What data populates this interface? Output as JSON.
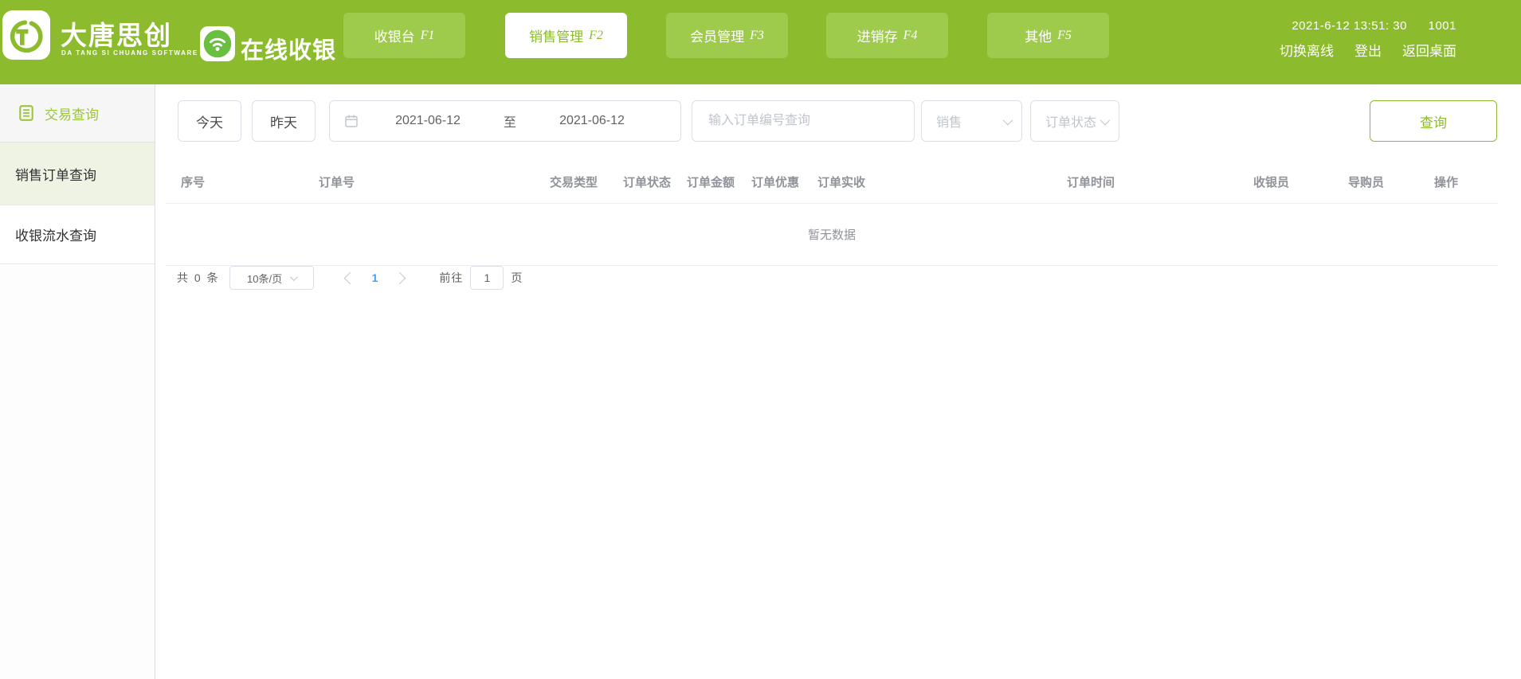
{
  "header": {
    "brand": {
      "name": "大唐思创",
      "subtitle": "DA TANG SI CHUANG SOFTWARE",
      "product": "在线收银"
    },
    "nav": [
      {
        "label": "收银台",
        "fkey": "F1"
      },
      {
        "label": "销售管理",
        "fkey": "F2"
      },
      {
        "label": "会员管理",
        "fkey": "F3"
      },
      {
        "label": "进销存",
        "fkey": "F4"
      },
      {
        "label": "其他",
        "fkey": "F5"
      }
    ],
    "info": {
      "datetime": "2021-6-12 13:51: 30",
      "terminal": "1001",
      "links": {
        "switch_offline": "切换离线",
        "logout": "登出",
        "back_desktop": "返回桌面"
      }
    }
  },
  "sidebar": {
    "items": [
      {
        "label": "交易查询",
        "icon": "document-list-icon"
      },
      {
        "label": "销售订单查询"
      },
      {
        "label": "收银流水查询"
      }
    ]
  },
  "filters": {
    "today": "今天",
    "yesterday": "昨天",
    "date_from": "2021-06-12",
    "to_label": "至",
    "date_to": "2021-06-12",
    "order_placeholder": "输入订单编号查询",
    "type_value": "销售",
    "status_placeholder": "订单状态",
    "search_label": "查询"
  },
  "table": {
    "columns": [
      "序号",
      "订单号",
      "交易类型",
      "订单状态",
      "订单金额",
      "订单优惠",
      "订单实收",
      "订单时间",
      "收银员",
      "导购员",
      "操作"
    ],
    "empty_text": "暂无数据"
  },
  "pagination": {
    "total": "共 0 条",
    "page_size": "10条/页",
    "current_page": "1",
    "goto_label": "前往",
    "goto_value": "1",
    "page_label": "页"
  },
  "colors": {
    "header_green": "#8cbb2e",
    "nav_button_green": "#9ecb4b",
    "active_text_green": "#8cbb2e",
    "sidebar_active_green": "#9cc53e",
    "link_blue": "#409eff",
    "gray_text": "#606266",
    "placeholder_gray": "#c0c4cc",
    "table_header_gray": "#909399"
  }
}
